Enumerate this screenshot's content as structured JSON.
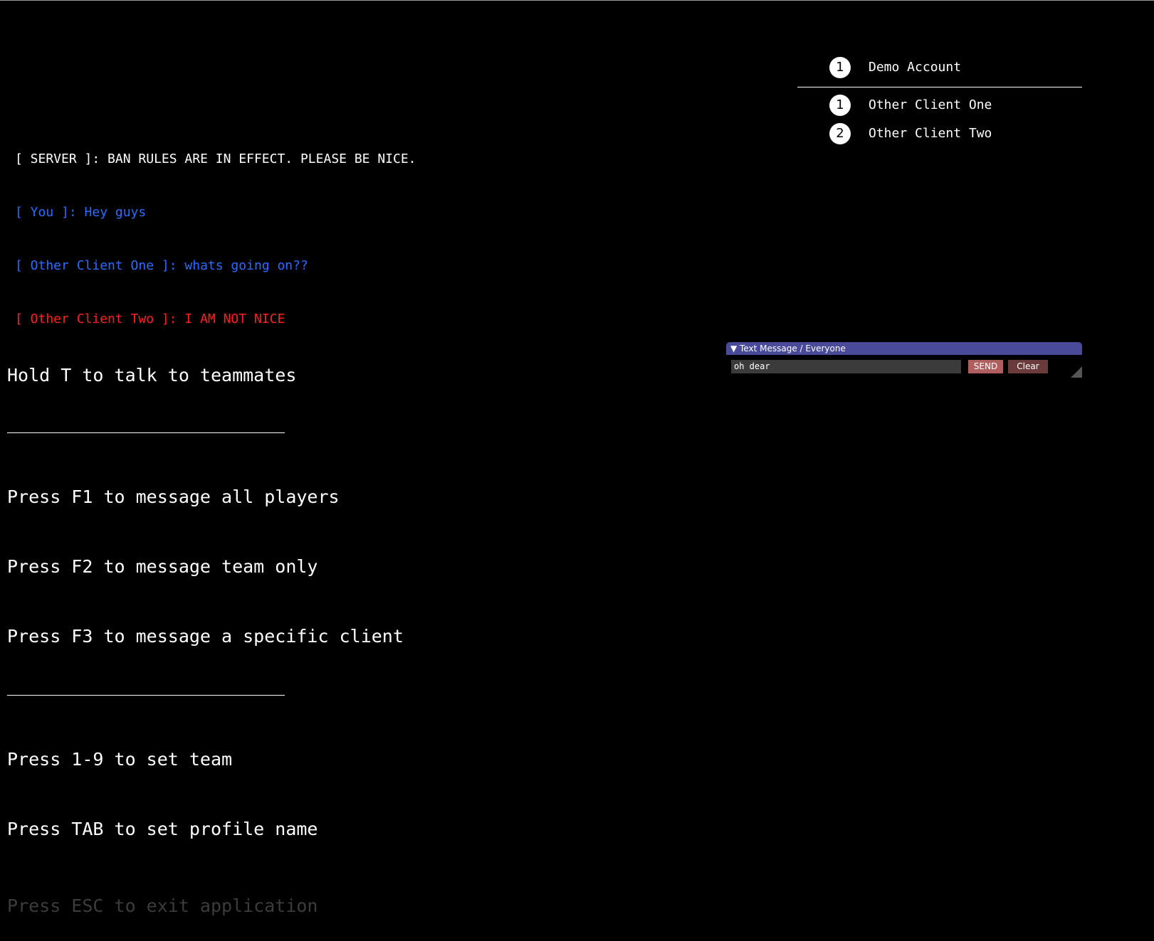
{
  "chat": {
    "lines": [
      {
        "text": "[ SERVER ]: BAN RULES ARE IN EFFECT. PLEASE BE NICE.",
        "color": "#ffffff"
      },
      {
        "text": "[ You ]: Hey guys",
        "color": "#2a6cff"
      },
      {
        "text": "[ Other Client One ]: whats going on??",
        "color": "#2a6cff"
      },
      {
        "text": "[ Other Client Two ]: I AM NOT NICE",
        "color": "#ff2020"
      }
    ]
  },
  "players": {
    "self": {
      "badge": "1",
      "name": "Demo Account"
    },
    "others": [
      {
        "badge": "1",
        "name": "Other Client One"
      },
      {
        "badge": "2",
        "name": "Other Client Two"
      }
    ]
  },
  "help": {
    "talk": "Hold T to talk to teammates",
    "f1": "Press F1 to message all players",
    "f2": "Press F2 to message team only",
    "f3": "Press F3 to message a specific client",
    "team": "Press 1-9 to set team",
    "tab": "Press TAB to set profile name",
    "esc": "Press ESC to exit application"
  },
  "text_message": {
    "title": "▼ Text Message / Everyone",
    "input_value": "oh dear",
    "send_label": "SEND",
    "clear_label": "Clear"
  },
  "colors": {
    "background": "#000000",
    "titlebar": "#4a4a9a",
    "send_button": "#b05e5e",
    "clear_button": "#6b3a3a"
  }
}
